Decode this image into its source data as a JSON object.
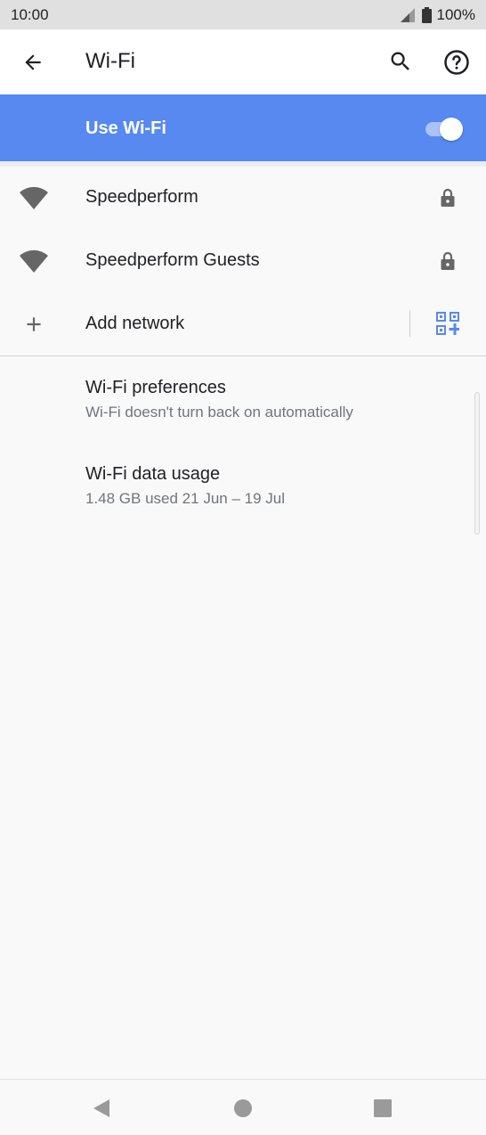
{
  "status_bar": {
    "time": "10:00",
    "battery": "100%",
    "signal_icon": "cell-signal-icon",
    "battery_icon": "battery-full-icon"
  },
  "app_bar": {
    "title": "Wi-Fi",
    "back_icon": "arrow-back-icon",
    "search_icon": "search-icon",
    "help_icon": "help-icon"
  },
  "master_switch": {
    "label": "Use Wi-Fi",
    "enabled": true,
    "accent": "#5789f0"
  },
  "networks": [
    {
      "name": "Speedperform",
      "secured": true,
      "icon": "wifi-signal-icon"
    },
    {
      "name": "Speedperform Guests",
      "secured": true,
      "icon": "wifi-signal-icon"
    }
  ],
  "add_network": {
    "label": "Add network",
    "icon": "plus-icon",
    "qr_icon": "qr-code-add-icon"
  },
  "preferences": [
    {
      "title": "Wi-Fi preferences",
      "summary": "Wi-Fi doesn't turn back on automatically"
    },
    {
      "title": "Wi-Fi data usage",
      "summary": "1.48 GB used 21 Jun – 19 Jul"
    }
  ],
  "nav_bar": {
    "back_icon": "nav-back-icon",
    "home_icon": "nav-home-icon",
    "recents_icon": "nav-recents-icon"
  }
}
